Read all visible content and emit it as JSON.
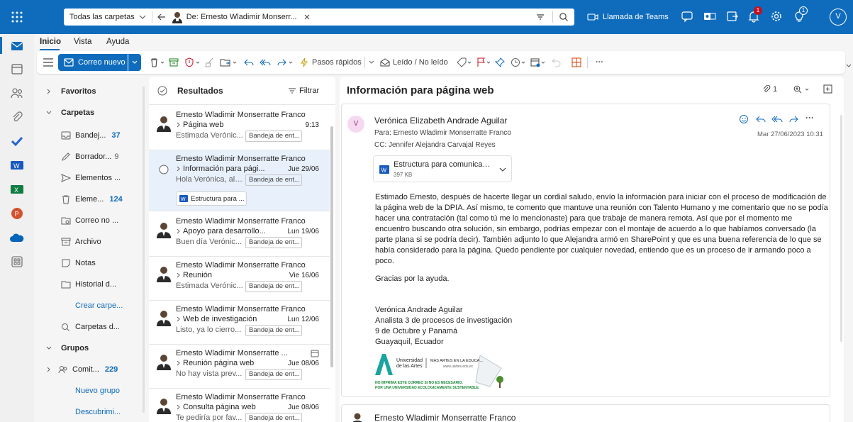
{
  "search": {
    "scope": "Todas las carpetas",
    "chip_label": "De: Ernesto Wladimir Monserr..."
  },
  "topbar": {
    "teams_label": "Llamada de Teams",
    "badge1": "1",
    "badge2": "1",
    "account_initial": "V"
  },
  "tabs": {
    "home": "Inicio",
    "view": "Vista",
    "help": "Ayuda"
  },
  "ribbon": {
    "new_mail": "Correo nuevo",
    "quick_steps": "Pasos rápidos",
    "read_unread": "Leído / No leído",
    "more": "···"
  },
  "folders": {
    "favorites": "Favoritos",
    "folders_header": "Carpetas",
    "inbox": "Bandej...",
    "inbox_count": "37",
    "drafts": "Borrador...",
    "drafts_count": "9",
    "sent": "Elementos ...",
    "deleted": "Eleme...",
    "deleted_count": "124",
    "junk": "Correo no ...",
    "archive": "Archivo",
    "notes": "Notas",
    "history": "Historial d...",
    "create_folder": "Crear carpe...",
    "search_folders": "Carpetas d...",
    "groups_header": "Grupos",
    "group1": "Comit...",
    "group1_count": "229",
    "new_group": "Nuevo grupo",
    "discover": "Descubrimi..."
  },
  "list": {
    "header": "Resultados",
    "filter": "Filtrar",
    "messages": [
      {
        "sender": "Ernesto Wladimir Monserratte Franco",
        "subject": "Página web",
        "date": "9:13",
        "preview": "Estimada Verónic...",
        "folder": "Bandeja de ent..."
      },
      {
        "sender": "Ernesto Wladimir Monserratte Franco",
        "subject": "Información para pági...",
        "date": "Jue 29/06",
        "preview": "Hola Verónica, al ...",
        "folder": "Bandeja de ent...",
        "attachment": "Estructura para ..."
      },
      {
        "sender": "Ernesto Wladimir Monserratte Franco",
        "subject": "Apoyo para desarrollo...",
        "date": "Lun 19/06",
        "preview": "Buen día Verónic...",
        "folder": "Bandeja de ent..."
      },
      {
        "sender": "Ernesto Wladimir Monserratte Franco",
        "subject": "Reunión",
        "date": "Vie 16/06",
        "preview": "Estimada Verónic...",
        "folder": "Bandeja de ent..."
      },
      {
        "sender": "Ernesto Wladimir Monserratte Franco",
        "subject": "Web de investigación",
        "date": "Lun 12/06",
        "preview": "Listo, ya lo cierro...",
        "folder": "Bandeja de ent..."
      },
      {
        "sender": "Ernesto Wladimir Monserratte ...",
        "subject": "Reunión página web",
        "date": "Jue 08/06",
        "preview": "No hay vista prev...",
        "folder": "Bandeja de ent..."
      },
      {
        "sender": "Ernesto Wladimir Monserratte Franco",
        "subject": "Consulta página web",
        "date": "Jue 08/06",
        "preview": "Te pediría por fav...",
        "folder": "Bandeja de ent..."
      }
    ]
  },
  "reading": {
    "subject": "Información para página web",
    "attach_count": "1",
    "from": "Verónica Elizabeth Andrade Aguilar",
    "from_initial": "V",
    "to": "Para:  Ernesto Wladimir Monserratte Franco",
    "cc": "CC:  Jennifer Alejandra Carvajal Reyes",
    "date": "Mar 27/06/2023 10:31",
    "attachment_name": "Estructura para comunicació...",
    "attachment_size": "397 KB",
    "body_p1": "Estimado Ernesto, después de hacerte llegar un cordial saludo, envío la información para iniciar con el proceso de modificación de la página web de la DPIA. Así mismo, te comento que mantuve una reunión con Talento Humano y me comentario que no se podía hacer una contratación (tal como tú me lo mencionaste) para que trabaje de manera remota. Así que por el momento me encuentro buscando otra solución, sin embargo, podrías empezar con el montaje de acuerdo a lo que habíamos conversado (la parte plana si se podría decir). También adjunto lo que Alejandra armó en SharePoint y que es una buena referencia de lo que se había considerado para la página. Quedo pendiente por cualquier novedad, entiendo que es un proceso de ir armando poco a poco.",
    "body_p2": "Gracias por la ayuda.",
    "sig_name": "Verónica Andrade Aguilar",
    "sig_role": "Analista 3 de procesos de investigación",
    "sig_address": "9 de Octubre y Panamá",
    "sig_city": "Guayaquil, Ecuador",
    "logo_uni": "Universidad de las Artes",
    "logo_slogan": "MÁS ARTES EN LA EDUCACIÓN",
    "logo_url": "www.uartes.edu.ec",
    "logo_note1": "NO IMPRIMA ESTE CORREO SI NO ES NECESARIO.",
    "logo_note2": "POR UNA UNIVERSIDAD ECOLÓGICAMENTE SUSTENTABLE.",
    "next_sender": "Ernesto Wladimir Monserratte Franco"
  },
  "colors": {
    "brand": "#0f6cbd",
    "accent_text": "#0f6cbd",
    "selected_row": "#e8f1fb"
  }
}
